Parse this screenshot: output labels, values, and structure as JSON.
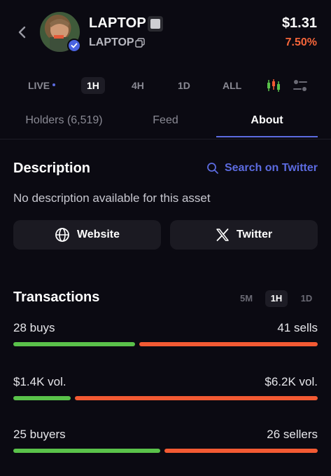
{
  "header": {
    "token_name": "LAPTOP",
    "token_ticker": "LAPTOP",
    "price": "$1.31",
    "change": "7.50%"
  },
  "timeframes": [
    "LIVE",
    "1H",
    "4H",
    "1D",
    "ALL"
  ],
  "timeframe_selected": "1H",
  "tabs": [
    {
      "label": "Holders (6,519)"
    },
    {
      "label": "Feed"
    },
    {
      "label": "About"
    }
  ],
  "tab_selected": "About",
  "description": {
    "title": "Description",
    "search_label": "Search on Twitter",
    "text": "No description available for this asset"
  },
  "links": {
    "website_label": "Website",
    "twitter_label": "Twitter"
  },
  "transactions": {
    "title": "Transactions",
    "timeframes": [
      "5M",
      "1H",
      "1D"
    ],
    "selected": "1H",
    "rows": [
      {
        "left": "28 buys",
        "right": "41 sells",
        "green_fraction": 0.406
      },
      {
        "left": "$1.4K vol.",
        "right": "$6.2K vol.",
        "green_fraction": 0.19
      },
      {
        "left": "25 buyers",
        "right": "26 sellers",
        "green_fraction": 0.49
      }
    ]
  },
  "colors": {
    "accent": "#5c6be0",
    "negative_change": "#f5653a",
    "buy": "#5ac24a",
    "sell": "#f35a33"
  }
}
